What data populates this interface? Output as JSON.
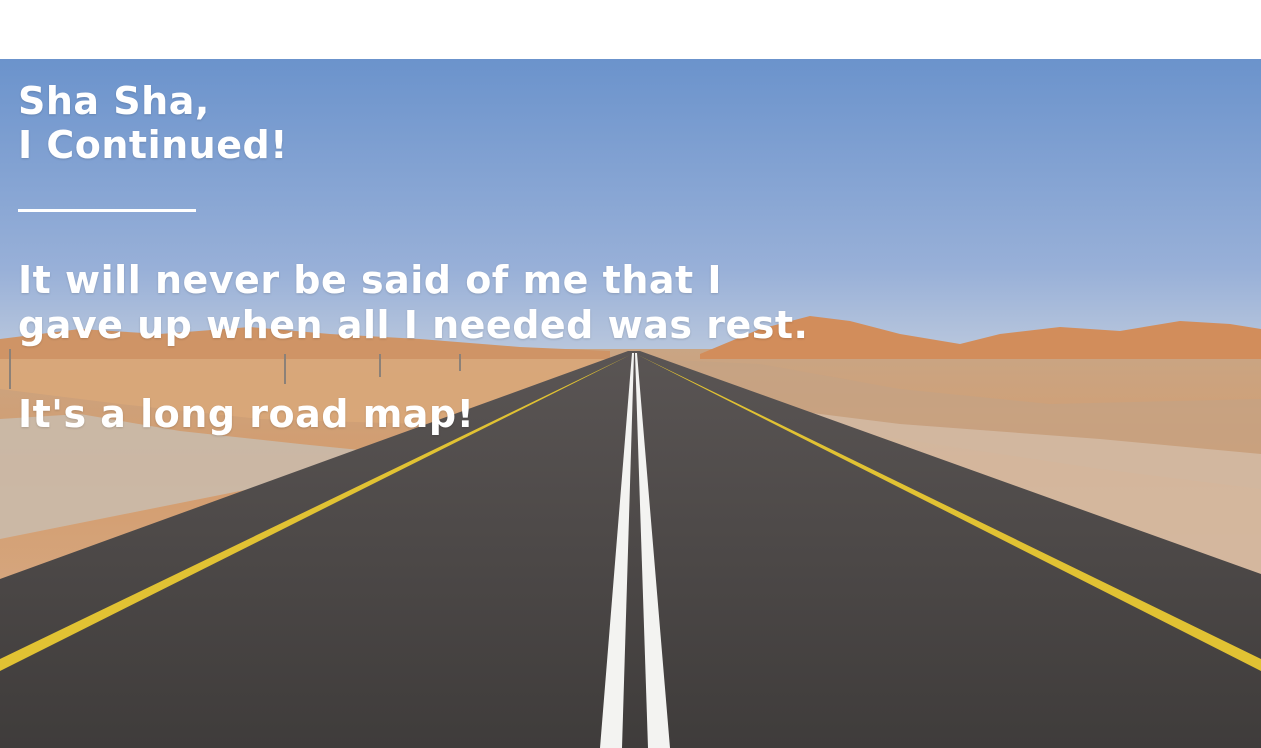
{
  "hero": {
    "title_line1": "Sha Sha,",
    "title_line2": "I Continued!",
    "quote": "It will never be said of me that I gave up when all I needed was rest.",
    "tagline": "It's a long road map!"
  },
  "colors": {
    "sky_top": "#6b93cc",
    "sky_horizon": "#b7c6dc",
    "sand": "#d9a77a",
    "dunes": "#d4905e",
    "road": "#4b4847",
    "road_lane": "#f3f3f1",
    "road_edge": "#e1c233",
    "text": "#ffffff"
  },
  "icons": {
    "background": "desert-road-photo"
  }
}
